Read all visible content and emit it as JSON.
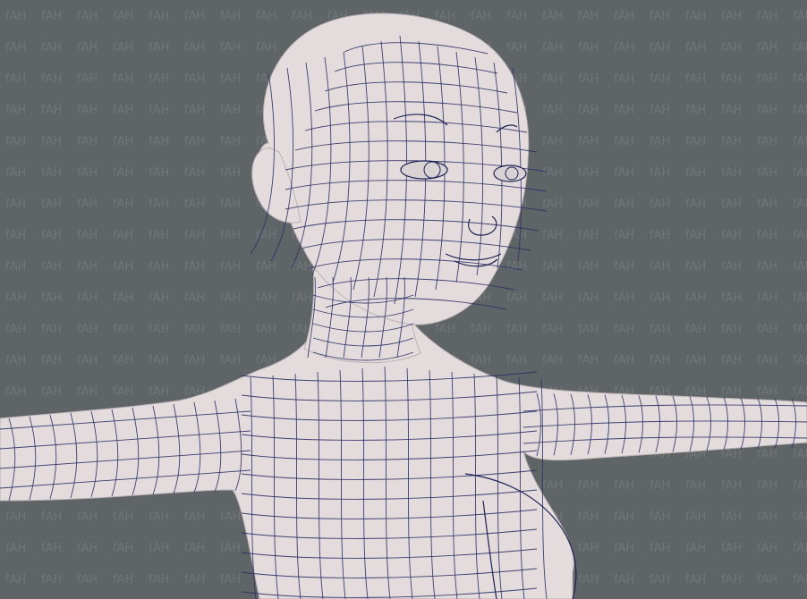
{
  "viewport": {
    "background_color": "#5f6467",
    "watermark_text": "fAH",
    "subject": "female cartoon base mesh wireframe",
    "colors": {
      "skin": "#e4dcdc",
      "wire": "#2a2f66",
      "watermark": "#707579"
    }
  }
}
